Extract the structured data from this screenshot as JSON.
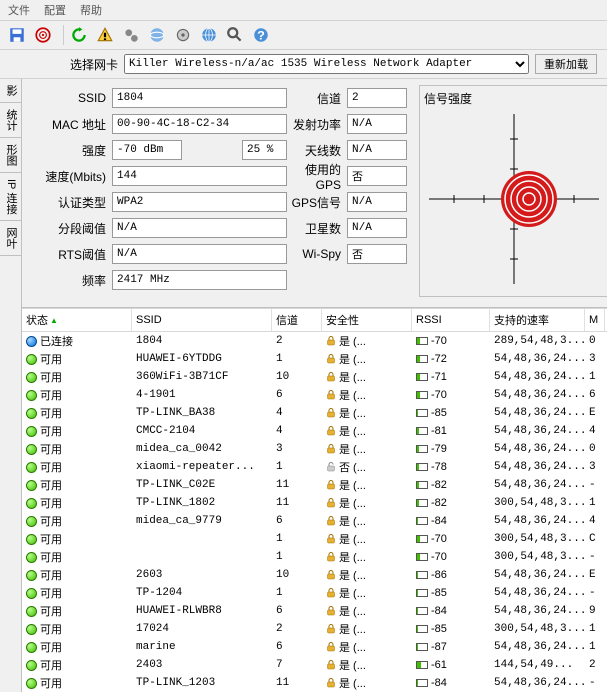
{
  "menu": {
    "file": "文件",
    "config": "配置",
    "help": "帮助"
  },
  "adapter": {
    "label": "选择网卡",
    "selected": "Killer Wireless-n/a/ac 1535 Wireless Network Adapter",
    "reload": "重新加载"
  },
  "side_tabs": [
    "影",
    "统计",
    "形图",
    "IP 连接",
    "网叶"
  ],
  "detail": {
    "labels": {
      "ssid": "SSID",
      "mac": "MAC 地址",
      "strength": "强度",
      "speed": "速度(Mbits)",
      "auth": "认证类型",
      "frag": "分段阈值",
      "rts": "RTS阈值",
      "freq": "频率",
      "channel": "信道",
      "txpower": "发射功率",
      "antenna": "天线数",
      "gps": "使用的GPS",
      "gpssig": "GPS信号",
      "satellite": "卫星数",
      "wispy": "Wi-Spy"
    },
    "values": {
      "ssid": "1804",
      "mac": "00-90-4C-18-C2-34",
      "strength_dbm": "-70 dBm",
      "strength_pct": "25 %",
      "speed": "144",
      "auth": "WPA2",
      "frag": "N/A",
      "rts": "N/A",
      "freq": "2417 MHz",
      "channel": "2",
      "txpower": "N/A",
      "antenna": "N/A",
      "gps": "否",
      "gpssig": "N/A",
      "satellite": "N/A",
      "wispy": "否"
    },
    "signal_title": "信号强度"
  },
  "grid": {
    "headers": {
      "status": "状态",
      "ssid": "SSID",
      "channel": "信道",
      "security": "安全性",
      "rssi": "RSSI",
      "rates": "支持的速率",
      "m": "M"
    },
    "rows": [
      {
        "status": "已连接",
        "status_color": "blue",
        "ssid": "1804",
        "channel": "2",
        "sec": "是 (...",
        "locked": true,
        "rssi": "-70",
        "rssi_lvl": "p30",
        "rates": "289,54,48,3...",
        "m": "0"
      },
      {
        "status": "可用",
        "ssid": "HUAWEI-6YTDDG",
        "channel": "1",
        "sec": "是 (...",
        "locked": true,
        "rssi": "-72",
        "rssi_lvl": "p30",
        "rates": "54,48,36,24...",
        "m": "3"
      },
      {
        "status": "可用",
        "ssid": "360WiFi-3B71CF",
        "channel": "10",
        "sec": "是 (...",
        "locked": true,
        "rssi": "-71",
        "rssi_lvl": "p30",
        "rates": "54,48,36,24...",
        "m": "1"
      },
      {
        "status": "可用",
        "ssid": "4-1901",
        "channel": "6",
        "sec": "是 (...",
        "locked": true,
        "rssi": "-70",
        "rssi_lvl": "p30",
        "rates": "54,48,36,24...",
        "m": "6"
      },
      {
        "status": "可用",
        "ssid": "TP-LINK_BA38",
        "channel": "4",
        "sec": "是 (...",
        "locked": true,
        "rssi": "-85",
        "rssi_lvl": "p10",
        "rates": "54,48,36,24...",
        "m": "E"
      },
      {
        "status": "可用",
        "ssid": "CMCC-2104",
        "channel": "4",
        "sec": "是 (...",
        "locked": true,
        "rssi": "-81",
        "rssi_lvl": "p20",
        "rates": "54,48,36,24...",
        "m": "4"
      },
      {
        "status": "可用",
        "ssid": "midea_ca_0042",
        "channel": "3",
        "sec": "是 (...",
        "locked": true,
        "rssi": "-79",
        "rssi_lvl": "p20",
        "rates": "54,48,36,24...",
        "m": "0"
      },
      {
        "status": "可用",
        "ssid": "xiaomi-repeater...",
        "channel": "1",
        "sec": "否 (...",
        "locked": false,
        "rssi": "-78",
        "rssi_lvl": "p20",
        "rates": "54,48,36,24...",
        "m": "3"
      },
      {
        "status": "可用",
        "ssid": "TP-LINK_C02E",
        "channel": "11",
        "sec": "是 (...",
        "locked": true,
        "rssi": "-82",
        "rssi_lvl": "p20",
        "rates": "54,48,36,24...",
        "m": "-"
      },
      {
        "status": "可用",
        "ssid": "TP-LINK_1802",
        "channel": "11",
        "sec": "是 (...",
        "locked": true,
        "rssi": "-82",
        "rssi_lvl": "p20",
        "rates": "300,54,48,3...",
        "m": "1"
      },
      {
        "status": "可用",
        "ssid": "midea_ca_9779",
        "channel": "6",
        "sec": "是 (...",
        "locked": true,
        "rssi": "-84",
        "rssi_lvl": "p10",
        "rates": "54,48,36,24...",
        "m": "4"
      },
      {
        "status": "可用",
        "ssid": "",
        "channel": "1",
        "sec": "是 (...",
        "locked": true,
        "rssi": "-70",
        "rssi_lvl": "p30",
        "rates": "300,54,48,3...",
        "m": "C"
      },
      {
        "status": "可用",
        "ssid": "",
        "channel": "1",
        "sec": "是 (...",
        "locked": true,
        "rssi": "-70",
        "rssi_lvl": "p30",
        "rates": "300,54,48,3...",
        "m": "-"
      },
      {
        "status": "可用",
        "ssid": "2603",
        "channel": "10",
        "sec": "是 (...",
        "locked": true,
        "rssi": "-86",
        "rssi_lvl": "p10",
        "rates": "54,48,36,24...",
        "m": "E"
      },
      {
        "status": "可用",
        "ssid": "TP-1204",
        "channel": "1",
        "sec": "是 (...",
        "locked": true,
        "rssi": "-85",
        "rssi_lvl": "p10",
        "rates": "54,48,36,24...",
        "m": "-"
      },
      {
        "status": "可用",
        "ssid": "HUAWEI-RLWBR8",
        "channel": "6",
        "sec": "是 (...",
        "locked": true,
        "rssi": "-84",
        "rssi_lvl": "p10",
        "rates": "54,48,36,24...",
        "m": "9"
      },
      {
        "status": "可用",
        "ssid": "17024",
        "channel": "2",
        "sec": "是 (...",
        "locked": true,
        "rssi": "-85",
        "rssi_lvl": "p10",
        "rates": "300,54,48,3...",
        "m": "1"
      },
      {
        "status": "可用",
        "ssid": "marine",
        "channel": "6",
        "sec": "是 (...",
        "locked": true,
        "rssi": "-87",
        "rssi_lvl": "p10",
        "rates": "54,48,36,24...",
        "m": "1"
      },
      {
        "status": "可用",
        "ssid": "2403",
        "channel": "7",
        "sec": "是 (...",
        "locked": true,
        "rssi": "-61",
        "rssi_lvl": "p40",
        "rates": "144,54,49...",
        "m": "2"
      },
      {
        "status": "可用",
        "ssid": "TP-LINK_1203",
        "channel": "11",
        "sec": "是 (...",
        "locked": true,
        "rssi": "-84",
        "rssi_lvl": "p10",
        "rates": "54,48,36,24...",
        "m": "-"
      }
    ]
  }
}
